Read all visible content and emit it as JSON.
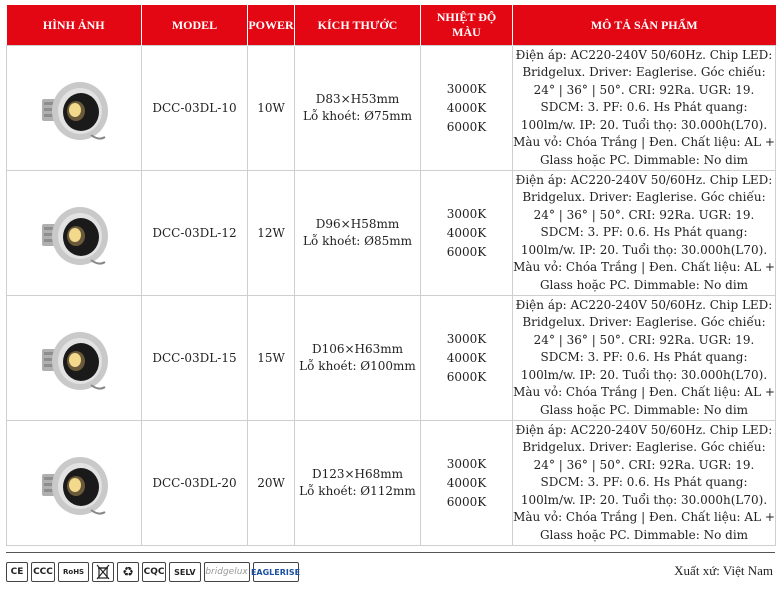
{
  "headers": {
    "image": "HÌNH ẢNH",
    "model": "MODEL",
    "power": "POWER",
    "size": "KÍCH THƯỚC",
    "temp": "NHIỆT ĐỘ MÀU",
    "desc": "MÔ TẢ SẢN PHẨM"
  },
  "rows": [
    {
      "model": "DCC-03DL-10",
      "power": "10W",
      "size": "D83×H53mm",
      "cutout": "Lỗ khoét: Ø75mm",
      "temps": [
        "3000K",
        "4000K",
        "6000K"
      ],
      "desc": "Điện áp: AC220-240V 50/60Hz. Chip LED: Bridgelux. Driver: Eaglerise. Góc chiếu: 24° | 36° | 50°. CRI: 92Ra. UGR: 19. SDCM: 3. PF: 0.6. Hs Phát quang: 100lm/w. IP: 20. Tuổi thọ: 30.000h(L70). Màu vỏ: Chóa Trắng | Đen. Chất liệu: AL + Glass hoặc PC. Dimmable: No dim"
    },
    {
      "model": "DCC-03DL-12",
      "power": "12W",
      "size": "D96×H58mm",
      "cutout": "Lỗ khoét: Ø85mm",
      "temps": [
        "3000K",
        "4000K",
        "6000K"
      ],
      "desc": "Điện áp: AC220-240V 50/60Hz. Chip LED: Bridgelux. Driver: Eaglerise. Góc chiếu: 24° | 36° | 50°. CRI: 92Ra. UGR: 19. SDCM: 3. PF: 0.6. Hs Phát quang: 100lm/w. IP: 20. Tuổi thọ: 30.000h(L70). Màu vỏ: Chóa Trắng | Đen. Chất liệu: AL + Glass hoặc PC. Dimmable: No dim"
    },
    {
      "model": "DCC-03DL-15",
      "power": "15W",
      "size": "D106×H63mm",
      "cutout": "Lỗ khoét: Ø100mm",
      "temps": [
        "3000K",
        "4000K",
        "6000K"
      ],
      "desc": "Điện áp: AC220-240V 50/60Hz. Chip LED: Bridgelux. Driver: Eaglerise. Góc chiếu: 24° | 36° | 50°. CRI: 92Ra. UGR: 19. SDCM: 3. PF: 0.6. Hs Phát quang: 100lm/w. IP: 20. Tuổi thọ: 30.000h(L70). Màu vỏ: Chóa Trắng | Đen. Chất liệu: AL + Glass hoặc PC. Dimmable: No dim"
    },
    {
      "model": "DCC-03DL-20",
      "power": "20W",
      "size": "D123×H68mm",
      "cutout": "Lỗ khoét: Ø112mm",
      "temps": [
        "3000K",
        "4000K",
        "6000K"
      ],
      "desc": "Điện áp: AC220-240V 50/60Hz. Chip LED: Bridgelux. Driver: Eaglerise. Góc chiếu: 24° | 36° | 50°. CRI: 92Ra. UGR: 19. SDCM: 3. PF: 0.6. Hs Phát quang: 100lm/w. IP: 20. Tuổi thọ: 30.000h(L70). Màu vỏ: Chóa Trắng | Đen. Chất liệu: AL + Glass hoặc PC. Dimmable: No dim"
    }
  ],
  "certs": [
    "CE",
    "CCC",
    "RoHS",
    "WEEE",
    "Recycle",
    "CQC",
    "SELV",
    "bridgelux",
    "EAGLERISE"
  ],
  "footer": {
    "origin": "Xuất xứ: Việt Nam"
  },
  "colors": {
    "header_bg": "#e30613",
    "header_text": "#ffffff"
  }
}
